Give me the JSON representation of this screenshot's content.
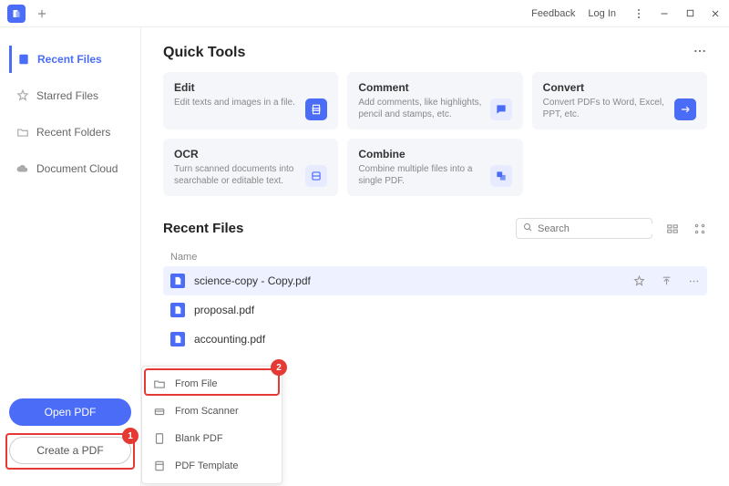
{
  "titlebar": {
    "feedback": "Feedback",
    "login": "Log In"
  },
  "sidebar": {
    "items": [
      {
        "label": "Recent Files"
      },
      {
        "label": "Starred Files"
      },
      {
        "label": "Recent Folders"
      },
      {
        "label": "Document Cloud"
      }
    ],
    "open_pdf": "Open PDF",
    "create_pdf": "Create a PDF"
  },
  "quick_tools": {
    "title": "Quick Tools",
    "cards": [
      {
        "title": "Edit",
        "desc": "Edit texts and images in a file."
      },
      {
        "title": "Comment",
        "desc": "Add comments, like highlights, pencil and stamps, etc."
      },
      {
        "title": "Convert",
        "desc": "Convert PDFs to Word, Excel, PPT, etc."
      },
      {
        "title": "OCR",
        "desc": "Turn scanned documents into searchable or editable text."
      },
      {
        "title": "Combine",
        "desc": "Combine multiple files into a single PDF."
      }
    ]
  },
  "recent_files": {
    "title": "Recent Files",
    "search_placeholder": "Search",
    "column_name": "Name",
    "rows": [
      {
        "name": "science-copy - Copy.pdf"
      },
      {
        "name": "proposal.pdf"
      },
      {
        "name": "accounting.pdf"
      }
    ]
  },
  "create_menu": {
    "items": [
      {
        "label": "From File"
      },
      {
        "label": "From Scanner"
      },
      {
        "label": "Blank PDF"
      },
      {
        "label": "PDF Template"
      }
    ]
  },
  "annotations": {
    "step1": "1",
    "step2": "2"
  }
}
